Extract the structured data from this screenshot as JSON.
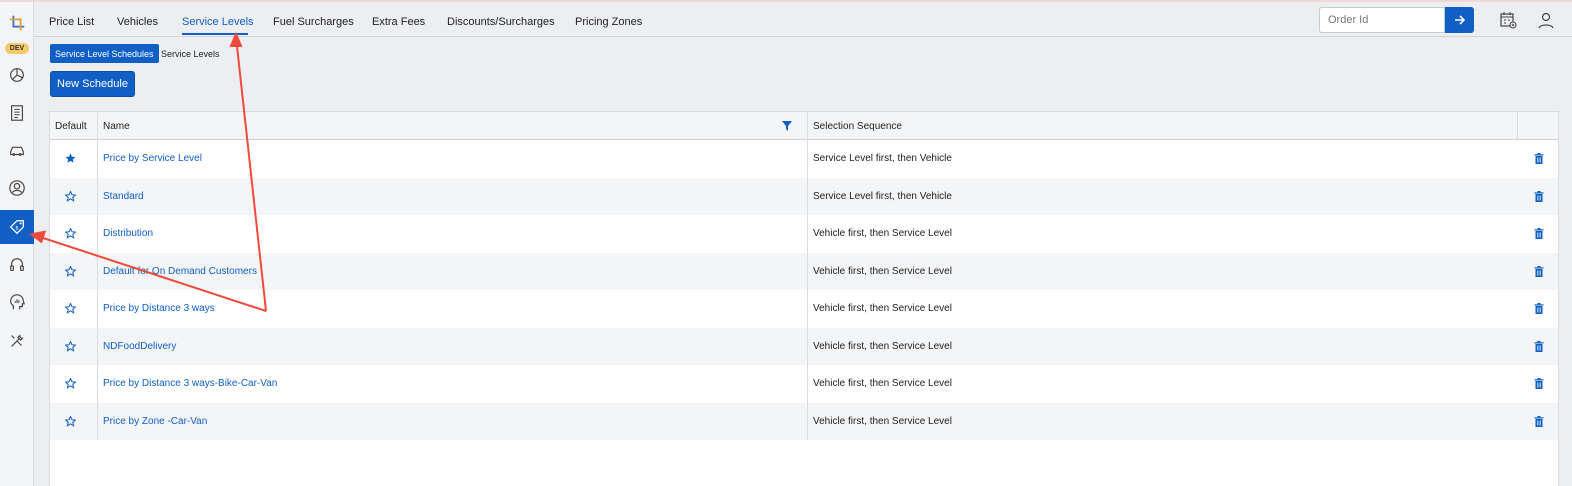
{
  "sidebar": {
    "badge": "DEV",
    "items": [
      {
        "icon": "crop-logo-icon"
      },
      {
        "icon": "pie-chart-icon"
      },
      {
        "icon": "receipt-icon"
      },
      {
        "icon": "car-icon"
      },
      {
        "icon": "user-circle-icon"
      },
      {
        "icon": "price-tag-icon",
        "active": true
      },
      {
        "icon": "headset-icon"
      },
      {
        "icon": "analytics-head-icon"
      },
      {
        "icon": "tools-icon"
      }
    ]
  },
  "tabs": [
    {
      "label": "Price List"
    },
    {
      "label": "Vehicles"
    },
    {
      "label": "Service Levels",
      "active": true
    },
    {
      "label": "Fuel Surcharges"
    },
    {
      "label": "Extra Fees"
    },
    {
      "label": "Discounts/Surcharges"
    },
    {
      "label": "Pricing Zones"
    }
  ],
  "search": {
    "placeholder": "Order Id",
    "go_icon": "arrow-right-icon"
  },
  "top_icons": [
    "calendar-add-icon",
    "user-icon"
  ],
  "subtabs": [
    {
      "label": "Service Level Schedules",
      "active": true
    },
    {
      "label": "Service Levels"
    }
  ],
  "new_button": {
    "label": "New Schedule"
  },
  "table": {
    "headers": {
      "default": "Default",
      "name": "Name",
      "sequence": "Selection Sequence"
    },
    "filter_icon": "filter-icon",
    "rows": [
      {
        "default": true,
        "name": "Price by Service Level",
        "sequence": "Service Level first, then Vehicle"
      },
      {
        "default": false,
        "name": "Standard",
        "sequence": "Service Level first, then Vehicle"
      },
      {
        "default": false,
        "name": "Distribution",
        "sequence": "Vehicle first, then Service Level"
      },
      {
        "default": false,
        "name": "Default for On Demand Customers",
        "sequence": "Vehicle first, then Service Level"
      },
      {
        "default": false,
        "name": "Price by Distance 3 ways",
        "sequence": "Vehicle first, then Service Level"
      },
      {
        "default": false,
        "name": "NDFoodDelivery",
        "sequence": "Vehicle first, then Service Level"
      },
      {
        "default": false,
        "name": "Price by Distance 3 ways-Bike-Car-Van",
        "sequence": "Vehicle first, then Service Level"
      },
      {
        "default": false,
        "name": "Price by Zone -Car-Van",
        "sequence": "Vehicle first, then Service Level"
      }
    ]
  },
  "colors": {
    "accent": "#0f5fc4",
    "annotation": "#ef4a3c"
  }
}
